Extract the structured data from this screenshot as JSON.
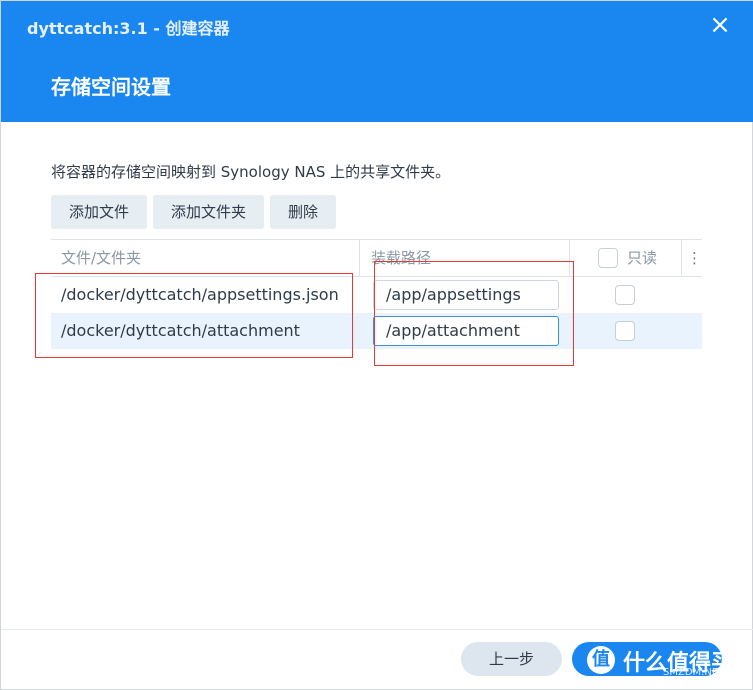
{
  "window": {
    "app_title": "dyttcatch:3.1 - 创建容器",
    "close_icon": "×",
    "page_title": "存储空间设置"
  },
  "description": "将容器的存储空间映射到 Synology NAS 上的共享文件夹。",
  "toolbar": {
    "add_file": "添加文件",
    "add_folder": "添加文件夹",
    "delete": "删除"
  },
  "grid": {
    "headers": {
      "file_folder": "文件/文件夹",
      "mount_path": "装载路径",
      "readonly": "只读",
      "menu_icon": "⋮"
    },
    "rows": [
      {
        "file_folder": "/docker/dyttcatch/appsettings.json",
        "mount_path": "/app/appsettings",
        "readonly": false
      },
      {
        "file_folder": "/docker/dyttcatch/attachment",
        "mount_path": "/app/attachment",
        "readonly": false
      }
    ]
  },
  "footer": {
    "prev": "上一步",
    "watermark_glyph": "值",
    "watermark_text": "什么值得买",
    "watermark_small": "SMZDM.NET"
  },
  "colors": {
    "header_bg": "#1a86f0",
    "annotation_red": "#e53935",
    "selected_row": "#e9f3fd"
  }
}
